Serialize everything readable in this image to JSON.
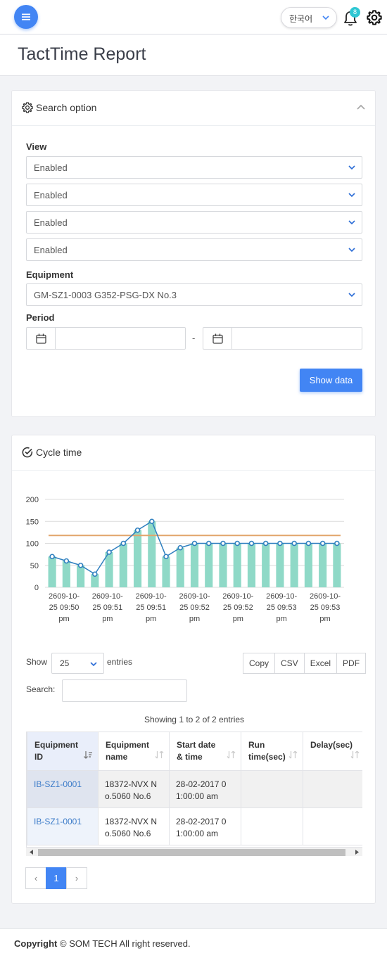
{
  "header": {
    "language": "한국어",
    "notification_count": "8"
  },
  "page": {
    "title": "TactTime Report"
  },
  "search_option": {
    "title": "Search option",
    "view_label": "View",
    "view_selects": [
      "Enabled",
      "Enabled",
      "Enabled",
      "Enabled"
    ],
    "equipment_label": "Equipment",
    "equipment_value": "GM-SZ1-0003 G352-PSG-DX No.3",
    "period_label": "Period",
    "period_start": "",
    "period_end": "",
    "period_separator": "-",
    "show_button": "Show data"
  },
  "cycle_time": {
    "title": "Cycle time"
  },
  "chart_data": {
    "type": "bar",
    "y_ticks": [
      0,
      50,
      100,
      150,
      200
    ],
    "ylim": [
      0,
      200
    ],
    "x_tick_labels": [
      [
        "2609-10-",
        "25 09:50",
        "pm"
      ],
      [
        "2609-10-",
        "25 09:51",
        "pm"
      ],
      [
        "2609-10-",
        "25 09:51",
        "pm"
      ],
      [
        "2609-10-",
        "25 09:52",
        "pm"
      ],
      [
        "2609-10-",
        "25 09:52",
        "pm"
      ],
      [
        "2609-10-",
        "25 09:53",
        "pm"
      ],
      [
        "2609-10-",
        "25 09:53",
        "pm"
      ]
    ],
    "values": [
      70,
      60,
      50,
      30,
      80,
      100,
      130,
      150,
      70,
      90,
      100,
      100,
      100,
      100,
      100,
      100,
      100,
      100,
      100,
      100,
      100
    ],
    "average_line": 118,
    "bar_color": "#8fd9c7",
    "line_color": "#2e7fbf",
    "average_color": "#e2a56b"
  },
  "datatable": {
    "show_label": "Show",
    "length_value": "25",
    "entries_label": "entries",
    "buttons": [
      "Copy",
      "CSV",
      "Excel",
      "PDF"
    ],
    "search_label": "Search:",
    "search_value": "",
    "info": "Showing 1 to 2 of 2 entries",
    "columns": [
      {
        "l1": "Equipment",
        "l2": "ID"
      },
      {
        "l1": "Equipment",
        "l2": "name"
      },
      {
        "l1": "Start date",
        "l2": "& time"
      },
      {
        "l1": "Run",
        "l2": "time(sec)"
      },
      {
        "l1": "Delay(sec)",
        "l2": ""
      }
    ],
    "rows": [
      {
        "id": "IB-SZ1-0001",
        "name_l1": "18372-NVX N",
        "name_l2": "o.5060 No.6",
        "start_l1": "28-02-2017 0",
        "start_l2": "1:00:00 am",
        "run": "",
        "delay": ""
      },
      {
        "id": "IB-SZ1-0001",
        "name_l1": "18372-NVX N",
        "name_l2": "o.5060 No.6",
        "start_l1": "28-02-2017 0",
        "start_l2": "1:00:00 am",
        "run": "",
        "delay": ""
      }
    ],
    "pager": {
      "prev": "‹",
      "current": "1",
      "next": "›"
    }
  },
  "footer": {
    "copyright_label": "Copyright",
    "text": "© SOM TECH All right reserved."
  },
  "colors": {
    "accent": "#4285f4",
    "badge": "#2ec7d3"
  }
}
